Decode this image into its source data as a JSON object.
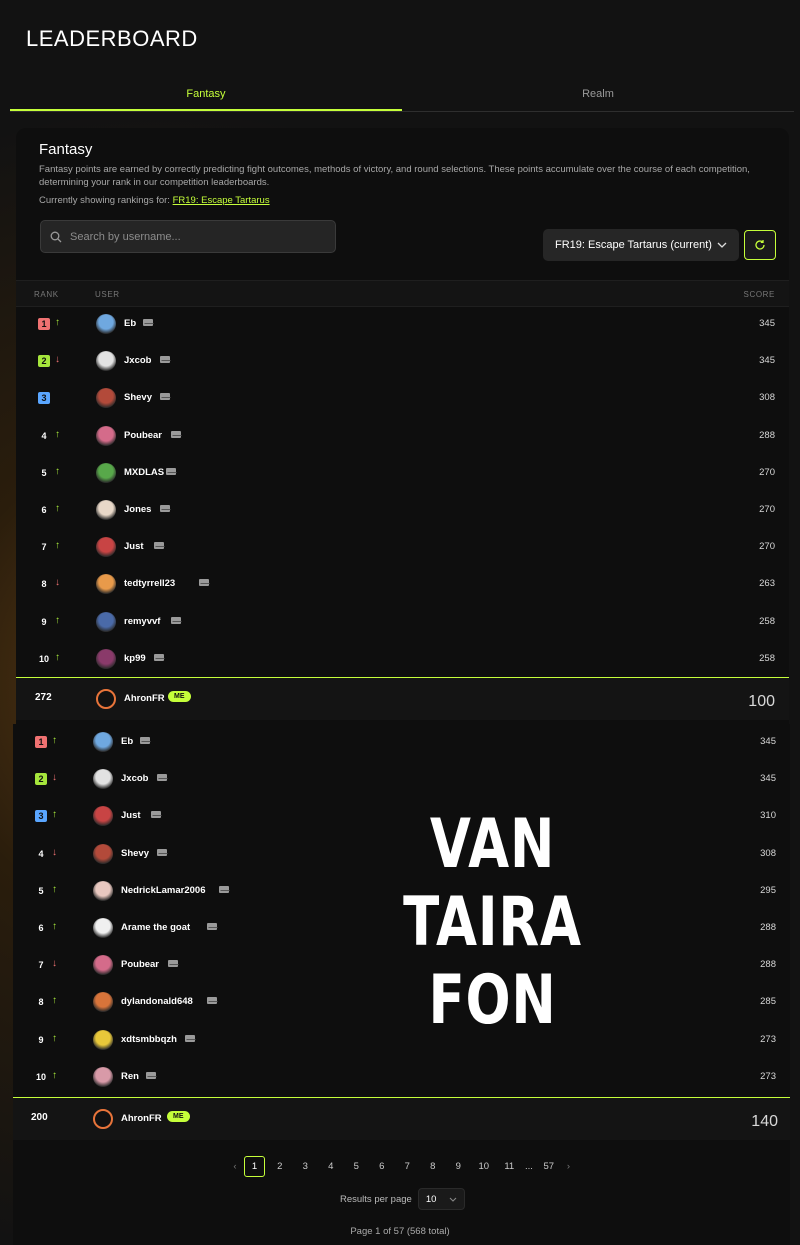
{
  "page": {
    "title": "LEADERBOARD"
  },
  "tabs": [
    {
      "label": "Fantasy"
    },
    {
      "label": "Realm"
    }
  ],
  "fantasy": {
    "title": "Fantasy",
    "description": "Fantasy points are earned by correctly predicting fight outcomes, methods of victory, and round selections. These points accumulate over the course of each competition, determining your rank in our competition leaderboards.",
    "showing_prefix": "Currently showing rankings for:",
    "showing_link": "FR19: Escape Tartarus",
    "search_placeholder": "Search by username...",
    "competition_select": "FR19: Escape Tartarus (current)"
  },
  "table": {
    "col_rank": "RANK",
    "col_user": "USER",
    "col_score": "SCORE"
  },
  "rows_top": [
    {
      "rank": "1",
      "trend": "up",
      "user": "Eb",
      "score": "345",
      "avatar_color": "#6fa8e0"
    },
    {
      "rank": "2",
      "trend": "down",
      "user": "Jxcob",
      "score": "345",
      "avatar_color": "#e2e2e2"
    },
    {
      "rank": "3",
      "trend": "none",
      "user": "Shevy",
      "score": "308",
      "avatar_color": "#b34a3a"
    },
    {
      "rank": "4",
      "trend": "up",
      "user": "Poubear",
      "score": "288",
      "avatar_color": "#d46b8a"
    },
    {
      "rank": "5",
      "trend": "up",
      "user": "MXDLAS",
      "score": "270",
      "avatar_color": "#58a84a"
    },
    {
      "rank": "6",
      "trend": "up",
      "user": "Jones",
      "score": "270",
      "avatar_color": "#e8d8c8"
    },
    {
      "rank": "7",
      "trend": "up",
      "user": "Just",
      "score": "270",
      "avatar_color": "#c84444"
    },
    {
      "rank": "8",
      "trend": "down",
      "user": "tedtyrrell23",
      "score": "263",
      "avatar_color": "#e89a4a"
    },
    {
      "rank": "9",
      "trend": "up",
      "user": "remyvvf",
      "score": "258",
      "avatar_color": "#4a6aa8"
    },
    {
      "rank": "10",
      "trend": "up",
      "user": "kp99",
      "score": "258",
      "avatar_color": "#8a3a6a"
    }
  ],
  "me_top": {
    "rank": "272",
    "user": "AhronFR",
    "badge": "ME",
    "score": "100"
  },
  "rows_bottom": [
    {
      "rank": "1",
      "trend": "up",
      "user": "Eb",
      "score": "345",
      "avatar_color": "#6fa8e0"
    },
    {
      "rank": "2",
      "trend": "down",
      "user": "Jxcob",
      "score": "345",
      "avatar_color": "#e2e2e2"
    },
    {
      "rank": "3",
      "trend": "up",
      "user": "Just",
      "score": "310",
      "avatar_color": "#c84444"
    },
    {
      "rank": "4",
      "trend": "down",
      "user": "Shevy",
      "score": "308",
      "avatar_color": "#b34a3a"
    },
    {
      "rank": "5",
      "trend": "up",
      "user": "NedrickLamar2006",
      "score": "295",
      "avatar_color": "#e8c8c0"
    },
    {
      "rank": "6",
      "trend": "up",
      "user": "Arame the goat",
      "score": "288",
      "avatar_color": "#f0f0f0"
    },
    {
      "rank": "7",
      "trend": "down",
      "user": "Poubear",
      "score": "288",
      "avatar_color": "#d46b8a"
    },
    {
      "rank": "8",
      "trend": "up",
      "user": "dylandonald648",
      "score": "285",
      "avatar_color": "#d8743a"
    },
    {
      "rank": "9",
      "trend": "up",
      "user": "xdtsmbbqzh",
      "score": "273",
      "avatar_color": "#e8c83a"
    },
    {
      "rank": "10",
      "trend": "up",
      "user": "Ren",
      "score": "273",
      "avatar_color": "#d89aa8"
    }
  ],
  "me_bottom": {
    "rank": "200",
    "user": "AhronFR",
    "badge": "ME",
    "score": "140"
  },
  "overlay": {
    "line1": "VAN TAIRA",
    "line2": "FON"
  },
  "pagination": {
    "pages": [
      "1",
      "2",
      "3",
      "4",
      "5",
      "6",
      "7",
      "8",
      "9",
      "10",
      "11",
      "...",
      "57"
    ],
    "current": "1",
    "results_per_page_label": "Results per page",
    "results_per_page_value": "10",
    "page_info": "Page 1 of 57 (568 total)"
  },
  "colors": {
    "accent": "#c5ff3a",
    "up": "#a6e63c",
    "down": "#f07272",
    "bronze": "#5aa6ff"
  }
}
